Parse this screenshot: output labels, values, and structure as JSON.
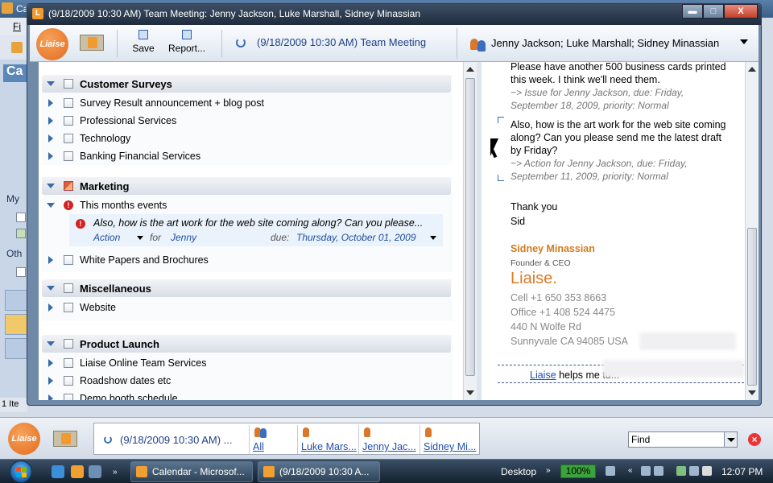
{
  "background_app": {
    "title": "Ca",
    "menu": "Fi",
    "nav_header": "Ca",
    "section_my": "My",
    "section_other": "Oth",
    "status": "1 Ite"
  },
  "window": {
    "title": "(9/18/2009 10:30 AM) Team Meeting: Jenny Jackson, Luke Marshall, Sidney Minassian",
    "minimize": "▬",
    "maximize": "□",
    "close": "X"
  },
  "toolbar": {
    "logo": "Liaise",
    "save_label": "Save",
    "report_label": "Report...",
    "meeting_title": "(9/18/2009 10:30 AM) Team Meeting",
    "people": "Jenny Jackson; Luke Marshall; Sidney Minassian"
  },
  "groups": [
    {
      "label": "Customer Surveys",
      "items": [
        "Survey Result  announcement + blog post",
        "Professional Services",
        "Technology",
        "Banking  Financial Services"
      ]
    },
    {
      "label": "Marketing",
      "items": [
        "This months events",
        "White Papers and  Brochures"
      ],
      "subitem": {
        "question": "Also, how is the art work for the web site coming along? Can you please...",
        "type": "Action",
        "for_label": "for",
        "person": "Jenny",
        "due_label": "due:",
        "due": "Thursday, October 01, 2009"
      }
    },
    {
      "label": "Miscellaneous",
      "items": [
        "Website"
      ]
    },
    {
      "label": "Product Launch",
      "items": [
        "Liaise Online Team Services",
        "Roadshow dates etc",
        "Demo booth schedule"
      ]
    }
  ],
  "email": {
    "line1": "Please have another 500 business cards printed",
    "line2": "this week. I think we'll need them.",
    "note1a": "~>   Issue for Jenny Jackson, due: Friday,",
    "note1b": "September 18, 2009, priority: Normal",
    "line3": "Also, how is the art work for the web site coming",
    "line4": "along? Can you please send me the latest draft",
    "line5": "by Friday?",
    "note2a": "~>   Action for Jenny Jackson, due: Friday,",
    "note2b": "September 11, 2009, priority: Normal",
    "thanks": "Thank you",
    "sign": "Sid",
    "sig_name": "Sidney Minassian",
    "sig_role": "Founder & CEO",
    "sig_brand": "Liaise.",
    "cell": "Cell +1 650 353 8663",
    "office": "Office +1 408 524 4475",
    "address1": "440 N Wolfe Rd",
    "address2": "Sunnyvale CA 94085 USA",
    "footer_link": "Liaise",
    "footer_text": " helps me tu..."
  },
  "liaise_bar": {
    "logo": "Liaise",
    "meeting": "(9/18/2009 10:30 AM) ...",
    "people": [
      "All",
      "Luke Mars...",
      "Jenny Jac...",
      "Sidney Mi..."
    ],
    "find": "Find",
    "close": "×"
  },
  "taskbar": {
    "tasks": [
      "Calendar - Microsof...",
      "(9/18/2009 10:30 A..."
    ],
    "desktop": "Desktop",
    "battery": "100%",
    "clock": "12:07 PM"
  }
}
